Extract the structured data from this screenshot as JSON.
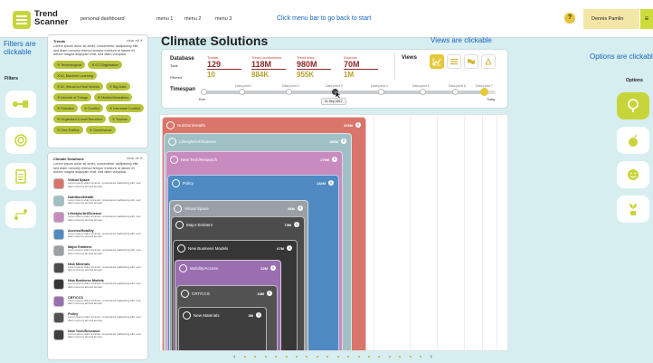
{
  "app": {
    "name_line1": "Trend",
    "name_line2": "Scanner",
    "tagline": "personal dashboard"
  },
  "nav": {
    "menu1": "menu 1",
    "menu2": "menu 2",
    "menu3": "menu 3"
  },
  "hints": {
    "menu": "Click menu bar to go back to start",
    "filters": "Filters are clickable",
    "views": "Views are clickable",
    "options": "Options are clickable"
  },
  "user": {
    "help": "?",
    "name": "Dennis Pamlin",
    "menu_icon": "≡"
  },
  "left_sidebar": {
    "label": "Filters"
  },
  "right_sidebar": {
    "label": "Options"
  },
  "trends_panel": {
    "title": "Trends",
    "close": "clear all ✕",
    "description": "Lorem ipsum dolor sit amet, consectetur sadipscing elitr, sed diam nonumy eirmod tempor invidunt ut labore et dolore magna aliquyam erat, sed diam voluptua.",
    "chips": [
      "✕ Technological",
      "✕ ICT/Digitisation",
      "✕ AI, Machine Learning",
      "✕ AI, Virtual-to-Real Worlds",
      "✕ Big Data",
      "✕ Internet of Things",
      "✕ Mobile/Wearables",
      "✕ Robotics",
      "✕ Conflict",
      "✕ Interstate Conflict",
      "✕ Organised Crime/Terrorism",
      "✕ Tourism",
      "✕ Geo-Politics",
      "✕ Governance"
    ]
  },
  "solutions_panel": {
    "title": "Climate Solutions",
    "close": "clear all ✕",
    "description": "Lorem ipsum dolor sit amet, consectetur sadipscing elitr, sed diam nonumy eirmod tempor invidunt ut labore et dolore magna aliquyam erat, sed diam voluptua.",
    "item_desc": "Lorem ipsum dolor sit amet, consectetur sadipscing elitr, sed diam nonumy eirmod tempor.",
    "items": [
      "Virtual Space",
      "Nutrition/Health",
      "Lifestyle/Art/Science",
      "Access/Mobility",
      "Major Emitters",
      "New Minerals",
      "New Business Models",
      "CRT/CCS",
      "Policy",
      "New Tech/Research"
    ]
  },
  "main": {
    "title": "Climate Solutions"
  },
  "database": {
    "label": "Database",
    "total_label": "Total",
    "filtered_label": "Filtered",
    "columns": [
      {
        "name": "Trends",
        "total": "129",
        "filtered": "10"
      },
      {
        "name": "Trend occurrences",
        "total": "118M",
        "filtered": "884K"
      },
      {
        "name": "Trend links",
        "total": "980M",
        "filtered": "955K"
      },
      {
        "name": "Sources",
        "total": "70M",
        "filtered": "1M"
      }
    ]
  },
  "views": {
    "label": "Views",
    "options": [
      "line-chart-icon",
      "list-icon",
      "map-icon",
      "network-icon"
    ],
    "active": "line-chart-icon"
  },
  "timespan": {
    "label": "Timespan",
    "start_label": "Ever",
    "end_label": "Today",
    "points": [
      "Data point 1",
      "Data point 2",
      "Data point 3",
      "Data point 4",
      "Data point 5",
      "Data point 6",
      "Data point 7"
    ],
    "selected_tooltip": "11 Sep 2017"
  },
  "chart_data": {
    "type": "nested-area",
    "items": [
      {
        "label": "Nutrition/Health",
        "value": "203M",
        "color": "#d9756b"
      },
      {
        "label": "Lifestyle/Art/Science",
        "value": "186M",
        "color": "#9fc1c6"
      },
      {
        "label": "New Tech/Research",
        "value": "179M",
        "color": "#c88bbf"
      },
      {
        "label": "Policy",
        "value": "132M",
        "color": "#4f8bc2"
      },
      {
        "label": "Virtual Space",
        "value": "86M",
        "color": "#9aa0a5"
      },
      {
        "label": "Major Emitters",
        "value": "73M",
        "color": "#4c4c4c"
      },
      {
        "label": "New Business Models",
        "value": "67M",
        "color": "#363636"
      },
      {
        "label": "Mobility/Access",
        "value": "22M",
        "color": "#9a6fb0"
      },
      {
        "label": "CRT/CCS",
        "value": "18M",
        "color": "#525252"
      },
      {
        "label": "New Materials",
        "value": "3M",
        "color": "#3e3e3e"
      }
    ]
  },
  "pager": {
    "prev": "‹",
    "next": "›"
  }
}
